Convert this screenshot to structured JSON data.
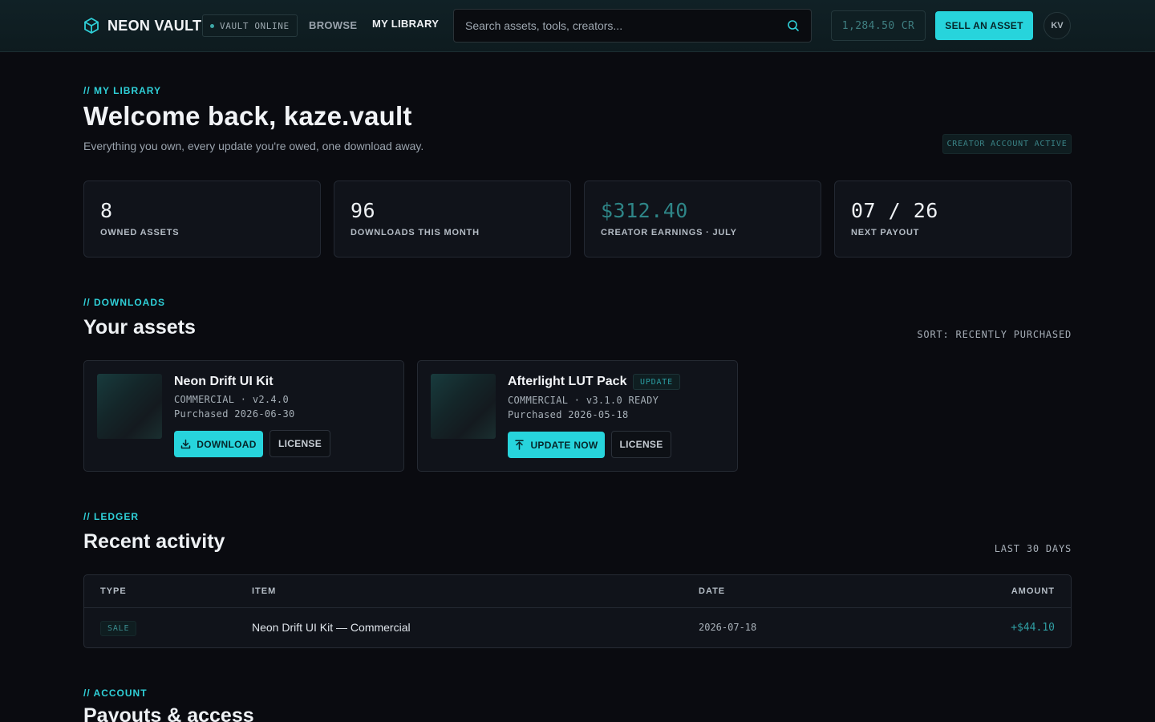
{
  "header": {
    "brand": "NEON VAULT",
    "status": "VAULT ONLINE",
    "nav": {
      "browse": "BROWSE",
      "library": "MY LIBRARY"
    },
    "search_placeholder": "Search assets, tools, creators...",
    "balance": "1,284.50 CR",
    "sell_label": "SELL AN ASSET",
    "avatar_initials": "KV"
  },
  "hero": {
    "eyebrow": "// MY LIBRARY",
    "title": "Welcome back, kaze.vault",
    "subtitle": "Everything you own, every update you're owed, one download away.",
    "badge": "CREATOR ACCOUNT ACTIVE"
  },
  "stats": [
    {
      "value": "8",
      "label": "OWNED ASSETS"
    },
    {
      "value": "96",
      "label": "DOWNLOADS THIS MONTH"
    },
    {
      "value": "$312.40",
      "label": "CREATOR EARNINGS · JULY"
    },
    {
      "value": "07 / 26",
      "label": "NEXT PAYOUT"
    }
  ],
  "downloads": {
    "eyebrow": "// DOWNLOADS",
    "title": "Your assets",
    "sort": "SORT: RECENTLY PURCHASED",
    "assets": [
      {
        "title": "Neon Drift UI Kit",
        "meta": "COMMERCIAL · v2.4.0",
        "purchased": "Purchased 2026-06-30",
        "primary": "DOWNLOAD",
        "secondary": "LICENSE"
      },
      {
        "title": "Afterlight LUT Pack",
        "tag": "UPDATE",
        "meta": "COMMERCIAL · v3.1.0 READY",
        "purchased": "Purchased 2026-05-18",
        "primary": "UPDATE NOW",
        "secondary": "LICENSE"
      }
    ]
  },
  "ledger": {
    "eyebrow": "// LEDGER",
    "title": "Recent activity",
    "range": "LAST 30 DAYS",
    "columns": [
      "TYPE",
      "ITEM",
      "DATE",
      "AMOUNT"
    ],
    "rows": [
      {
        "type": "SALE",
        "item": "Neon Drift UI Kit — Commercial",
        "date": "2026-07-18",
        "amount": "+$44.10"
      }
    ]
  },
  "account": {
    "eyebrow": "// ACCOUNT",
    "title": "Payouts & access"
  },
  "colors": {
    "accent": "#27d4dc",
    "background": "#0a0b10",
    "card": "#10131a",
    "muted_teal": "#2e8587"
  },
  "icons": [
    "cube-logo-icon",
    "status-dot-icon",
    "search-icon",
    "download-icon",
    "upload-arrow-icon"
  ]
}
